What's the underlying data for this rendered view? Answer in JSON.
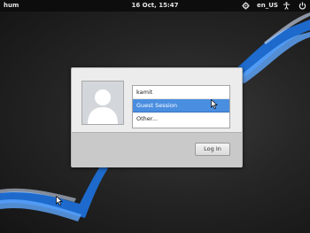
{
  "topbar": {
    "hostname": "hum",
    "datetime": "16 Oct, 15:47",
    "locale": "en_US",
    "icons": [
      "gear-icon",
      "accessibility-icon",
      "power-icon"
    ]
  },
  "login": {
    "users": [
      {
        "label": "kamit",
        "selected": false
      },
      {
        "label": "Guest Session",
        "selected": true
      },
      {
        "label": "Other...",
        "selected": false
      }
    ],
    "login_button": "Log In"
  },
  "colors": {
    "accent": "#4a8ee0",
    "wallpaper_stripe": "#2a7de0"
  }
}
